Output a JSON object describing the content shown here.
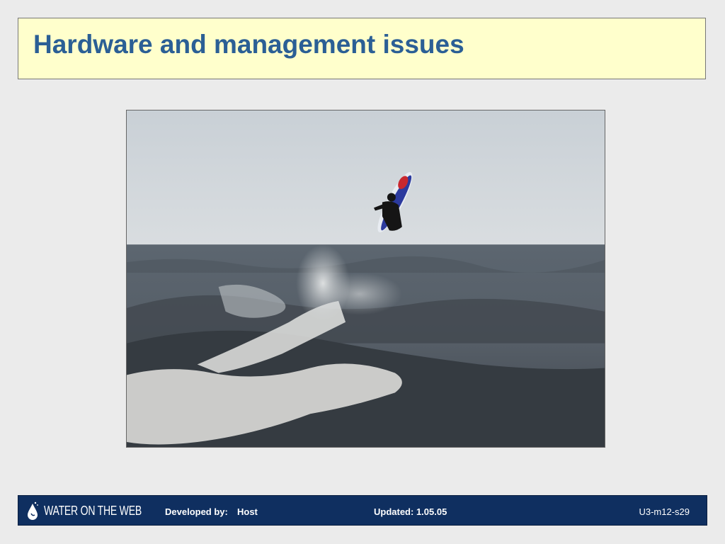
{
  "slide": {
    "title": "Hardware and management issues"
  },
  "photo": {
    "description_icon": "jet-ski-photo"
  },
  "footer": {
    "logo_text": "WATER ON THE WEB",
    "developed_by_label": "Developed by:",
    "developer": "Host",
    "updated": "Updated: 1.05.05",
    "slide_id": "U3-m12-s29"
  },
  "colors": {
    "title": "#2b5f95",
    "title_bg": "#ffffcc",
    "footer_bg": "#0f2f60",
    "page_bg": "#ebebeb"
  }
}
